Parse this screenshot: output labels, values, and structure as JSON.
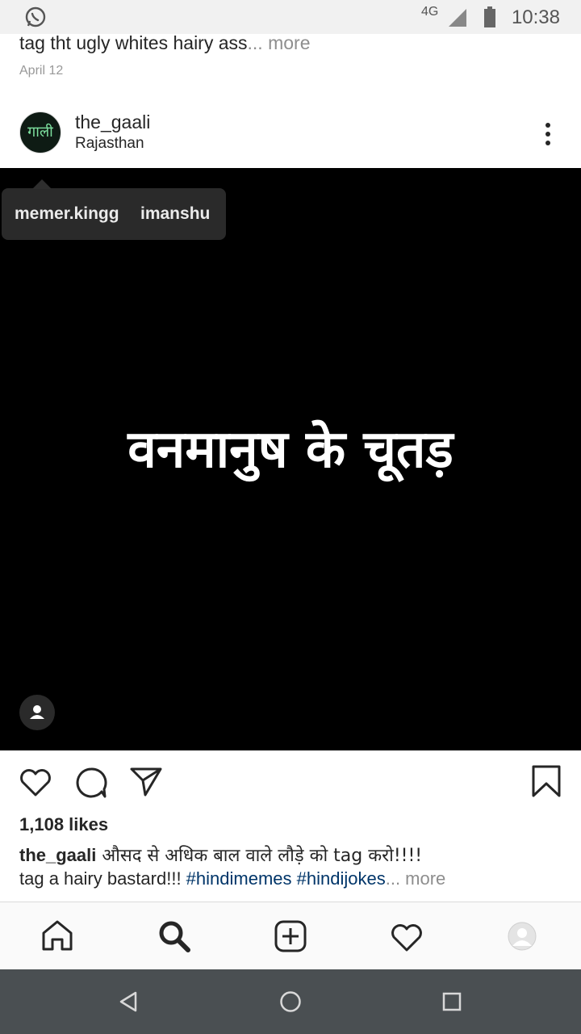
{
  "status_bar": {
    "network": "4G",
    "time": "10:38"
  },
  "previous_post": {
    "caption": "tag tht ugly whites hairy ass",
    "more_label": "... more",
    "date": "April 12"
  },
  "post": {
    "username": "the_gaali",
    "location": "Rajasthan",
    "avatar_text": "गाली",
    "image_text": "वनमानुष के चूतड़",
    "tags": [
      "memer.kingg",
      "imanshu"
    ],
    "likes": "1,108 likes",
    "caption_user": "the_gaali",
    "caption_text": " औसद से अधिक बाल वाले लौड़े को tag करो!!!!",
    "caption_line2": "tag a hairy bastard!!! ",
    "hashtags": [
      "#hindimemes",
      "#hindijokes"
    ],
    "more_label": "... more"
  },
  "bottom_nav": {
    "items": [
      "home-icon",
      "search-icon",
      "add-icon",
      "heart-icon",
      "profile-icon"
    ]
  },
  "colors": {
    "hashtag": "#003569",
    "muted": "#8e8e8e",
    "system_bar": "#4a4f52"
  }
}
